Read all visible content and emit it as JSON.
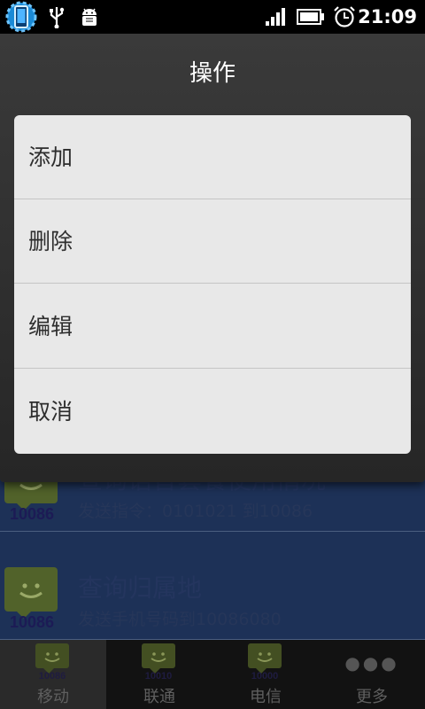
{
  "status_bar": {
    "time": "21:09",
    "icons": [
      "phone-settings-icon",
      "usb-icon",
      "android-debug-icon",
      "signal-icon",
      "battery-icon",
      "alarm-icon"
    ]
  },
  "dialog": {
    "title": "操作",
    "items": [
      {
        "label": "添加"
      },
      {
        "label": "删除"
      },
      {
        "label": "编辑"
      },
      {
        "label": "取消"
      }
    ]
  },
  "list": {
    "items": [
      {
        "icon_number": "10086",
        "title": "查询语音套餐使用情况",
        "subtitle": "发送指令：0101021 到10086"
      },
      {
        "icon_number": "10086",
        "title": "查询归属地",
        "subtitle": "发送手机号码到10086080"
      }
    ]
  },
  "tabs": [
    {
      "label": "移动",
      "icon_number": "10086",
      "selected": true
    },
    {
      "label": "联通",
      "icon_number": "10010",
      "selected": false
    },
    {
      "label": "电信",
      "icon_number": "10000",
      "selected": false
    },
    {
      "label": "更多",
      "icon": "more-dots-icon",
      "selected": false
    }
  ],
  "colors": {
    "dialog_bg": "#2f2f2f",
    "menu_bg": "#e8e8e8",
    "list_bg": "#1d3157",
    "icon_bubble": "#51622a"
  }
}
